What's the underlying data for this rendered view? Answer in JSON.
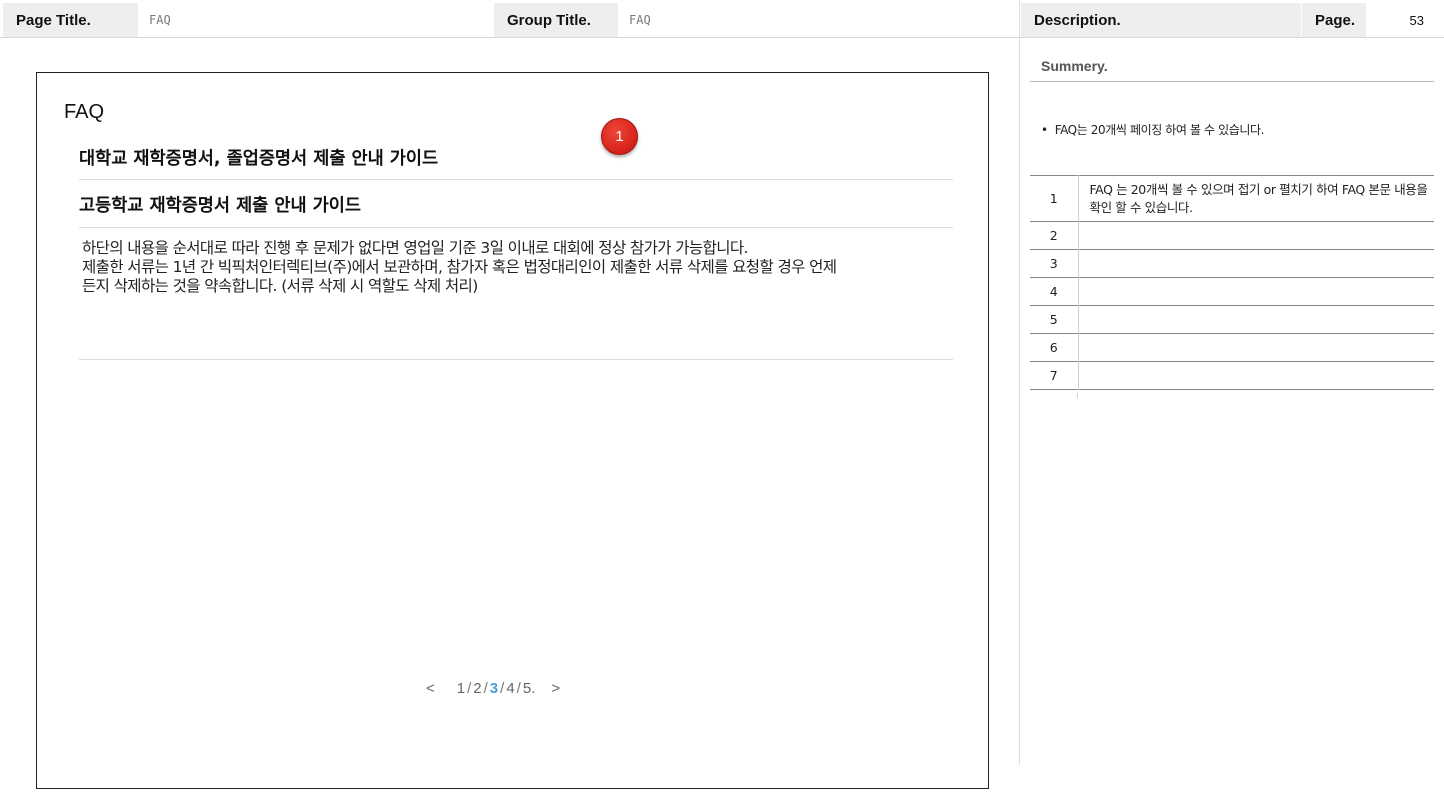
{
  "header": {
    "page_title_label": "Page Title.",
    "page_title_value": "FAQ",
    "group_title_label": "Group Title.",
    "group_title_value": "FAQ",
    "description_label": "Description.",
    "page_label": "Page.",
    "page_number": "53"
  },
  "faq": {
    "title": "FAQ",
    "questions": [
      "대학교 재학증명서, 졸업증명서 제출 안내 가이드",
      "고등학교 재학증명서 제출 안내 가이드"
    ],
    "answer_lines": [
      "하단의 내용을 순서대로 따라 진행 후 문제가 없다면 영업일 기준 3일 이내로 대회에 정상 참가가 가능합니다.",
      "제출한 서류는 1년 간 빅픽처인터렉티브(주)에서 보관하며, 참가자 혹은 법정대리인이 제출한 서류 삭제를 요청할 경우 언제",
      "든지 삭제하는 것을 약속합니다. (서류 삭제 시 역할도 삭제 처리)"
    ],
    "badge_number": "1"
  },
  "pagination": {
    "prev": "<",
    "next": ">",
    "pages": [
      "1",
      "2",
      "3",
      "4",
      "5."
    ],
    "current": "3"
  },
  "description": {
    "summary_title": "Summery.",
    "bullet": "FAQ는 20개씩 페이징 하여 볼 수 있습니다.",
    "rows": [
      {
        "num": "1",
        "text": "FAQ 는 20개씩 볼 수 있으며 접기 or 펼치기 하여 FAQ 본문 내용을 확인 할 수 있습니다."
      },
      {
        "num": "2",
        "text": ""
      },
      {
        "num": "3",
        "text": ""
      },
      {
        "num": "4",
        "text": ""
      },
      {
        "num": "5",
        "text": ""
      },
      {
        "num": "6",
        "text": ""
      },
      {
        "num": "7",
        "text": ""
      }
    ]
  },
  "colors": {
    "badge": "#d8261c",
    "current_page": "#4aa0d6",
    "header_label_bg": "#eeeeee"
  }
}
